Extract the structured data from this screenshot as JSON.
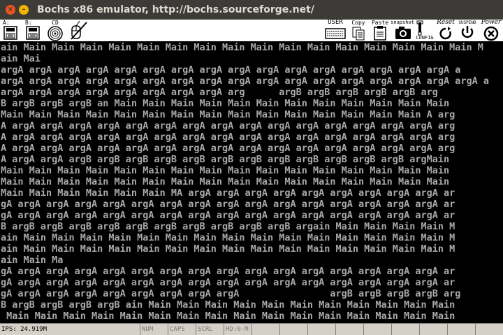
{
  "window": {
    "title": "Bochs x86 emulator, http://bochs.sourceforge.net/"
  },
  "toolbar": {
    "floppy_a": "A:",
    "floppy_b": "B:",
    "cdrom": "CD",
    "user": "USER",
    "copy": "Copy",
    "paste": "Paste",
    "snapshot": "snapshot",
    "config": "CONFIG",
    "reset": "Reset",
    "suspend": "SUSPEND",
    "power": "Power"
  },
  "screen": {
    "lines": [
      "ain Main Main Main Main Main Main Main Main Main Main Main Main Main Main Main Main M",
      "ain Mai",
      "argA argA argA argA argA argA argA argA argA argA argA argA argA argA argA argA a",
      "argA argA argA argA argA argA argA argA argA argA argA argA argA argA argA argA argA a",
      "argA argA argA argA argA argA argA argA arg      argB argB argB argB argB arg",
      "B argB argB argB an Main Main Main Main Main Main Main Main Main Main Main Main",
      "Main Main Main Main Main Main Main Main Main Main Main Main Main Main Main A arg",
      "A argA argA argA argA argA argA argA argA argA argA argA argA argA argA argA arg",
      "A argA argA argA argA argA argA argA argA argA argA argA argA argA argA argA arg",
      "A argA argA argA argA argA argA argA argA argA argA argA argA argA argA argA arg",
      "A argA argA argB argB argB argB argB argB argB argB argB argB argB argB argMain",
      "Main Main Main Main Main Main Main Main Main Main Main Main Main Main Main Main",
      "Main Main Main Main Main Main Main Main Main Main Main Main Main Main Main Main",
      "Main Main Main Main Main Main MA argA argA argA argA argA argA argA argA argA ar",
      "gA argA argA argA argA argA argA argA argA argA argA argA argA argA argA argA ar",
      "gA argA argA argA argA argA argA argA argA argA argA argA argA argA argA argA ar",
      "B argB argB argB argB argB argB argB argB argB argB argain Main Main Main Main M",
      "ain Main Main Main Main Main Main Main Main Main Main Main Main Main Main Main M",
      "ain Main Main Main Main Main Main Main Main Main Main Main Main Main Main Main M",
      "ain Main Ma",
      "gA argA argA argA argA argA argA argA argA argA argA argA argA argA argA argA ar",
      "gA argA argA argA argA argA argA argA argA argA argA argA argA argA argA argA ar",
      "gA argA argA argA argA argA argA argA argA                argB argB argB argB arg",
      "B argB argB argB argB ain Main Main Main Main Main Main Main Main Main Main Main",
      " Main Main Main Main Main Main Main Main Main Main Main Main Main Main Main Main"
    ]
  },
  "statusbar": {
    "ips": "IPS: 24.919M",
    "num": "NUM",
    "caps": "CAPS",
    "scrl": "SCRL",
    "hd": "HD:0-M"
  }
}
